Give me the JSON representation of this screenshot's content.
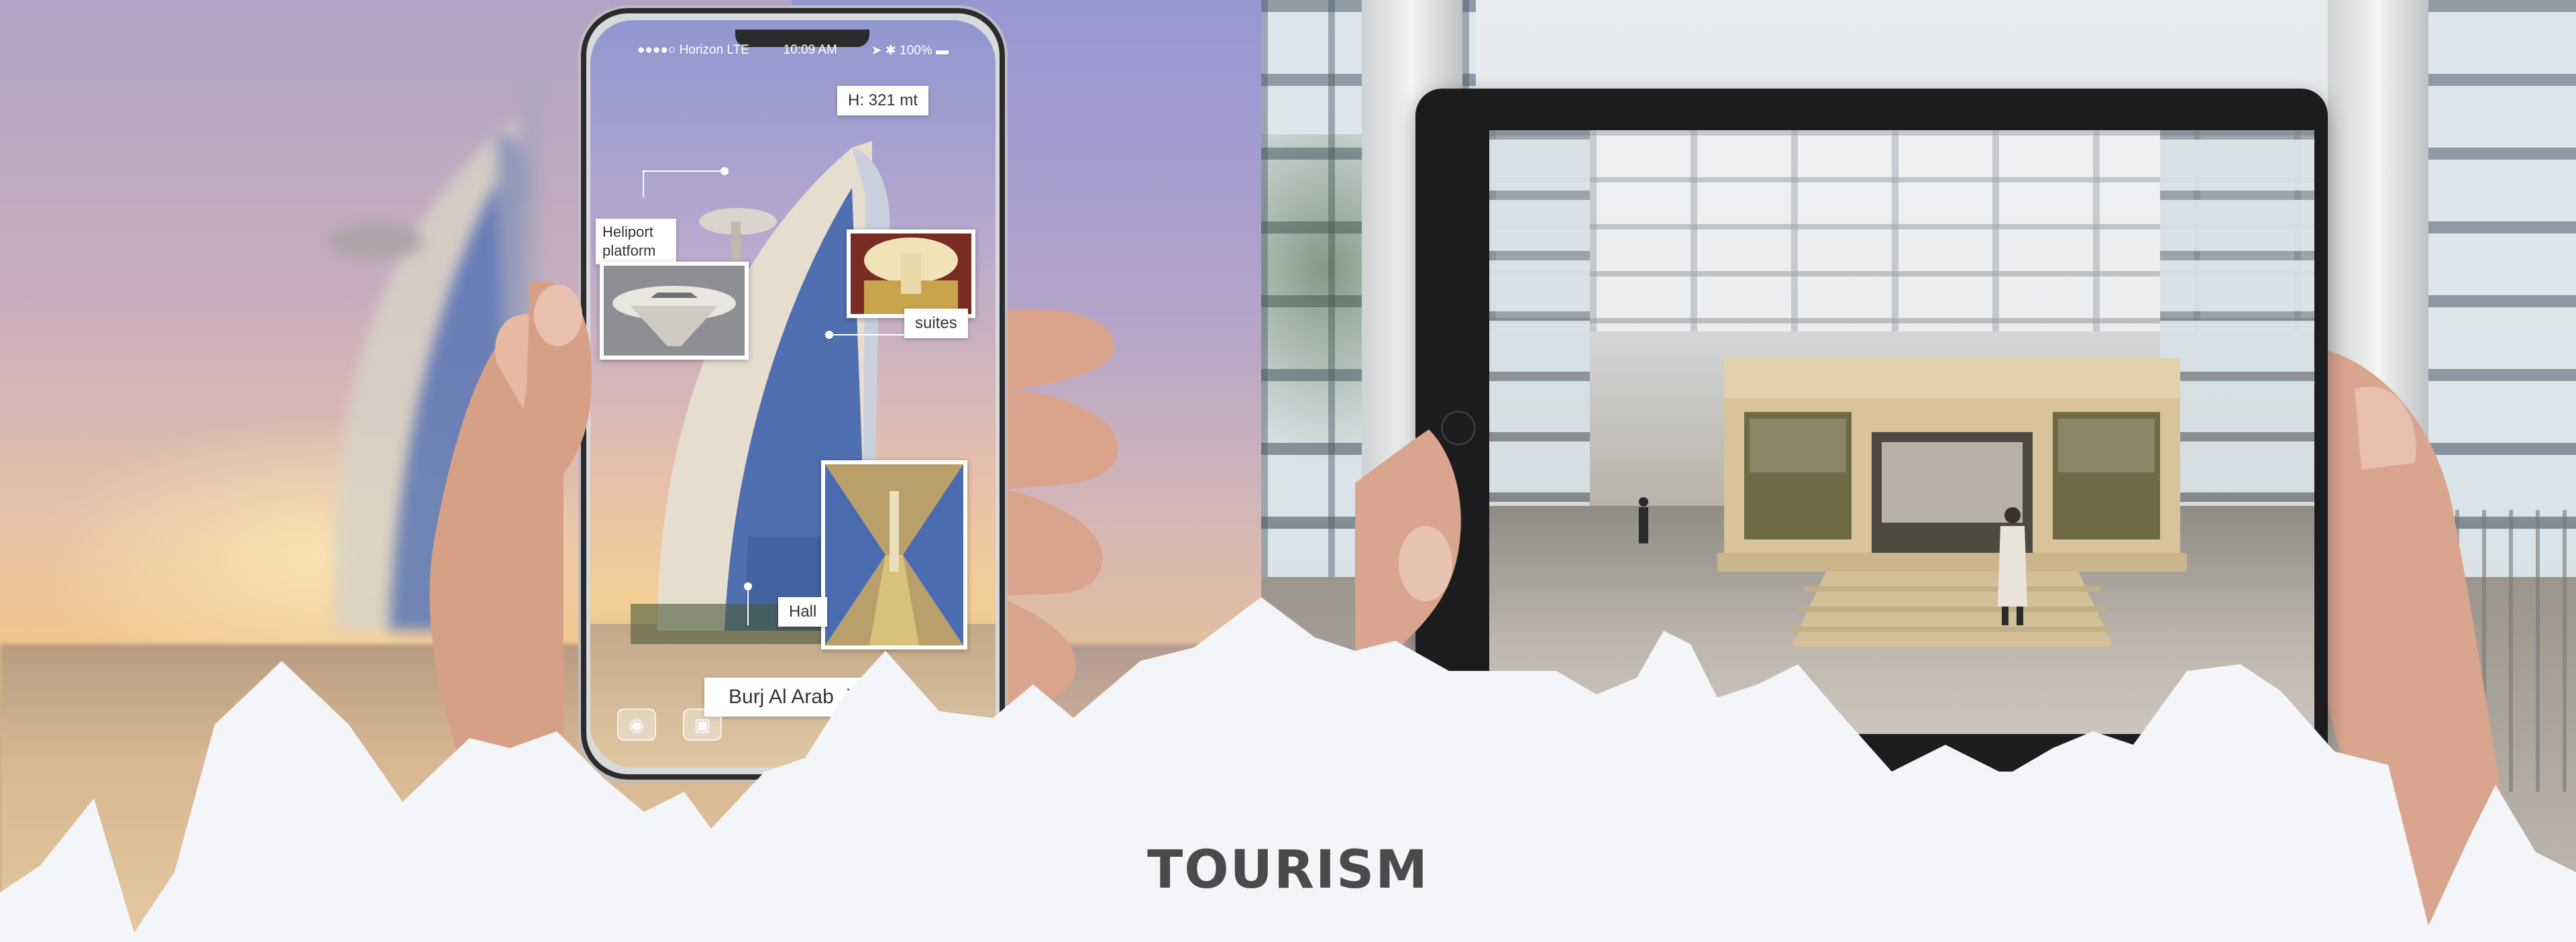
{
  "phone": {
    "status": {
      "carrier": "●●●●○ Horizon  LTE",
      "time": "10:09 AM",
      "battery": "➤ ✱ 100% ▬"
    },
    "callouts": {
      "height": "H: 321 mt",
      "heliport": "Heliport platform",
      "suites": "suites",
      "hall": "Hall",
      "name": "Burj Al Arab",
      "name_cut": "istr"
    },
    "dock": [
      "camera-icon",
      "gallery-icon"
    ]
  },
  "tablet": {
    "scene": "museum-altar"
  },
  "title": "TOURISM",
  "colors": {
    "background": "#f4f5f9",
    "title": "#4a4a4a",
    "tablet": "#1c1c1e"
  }
}
